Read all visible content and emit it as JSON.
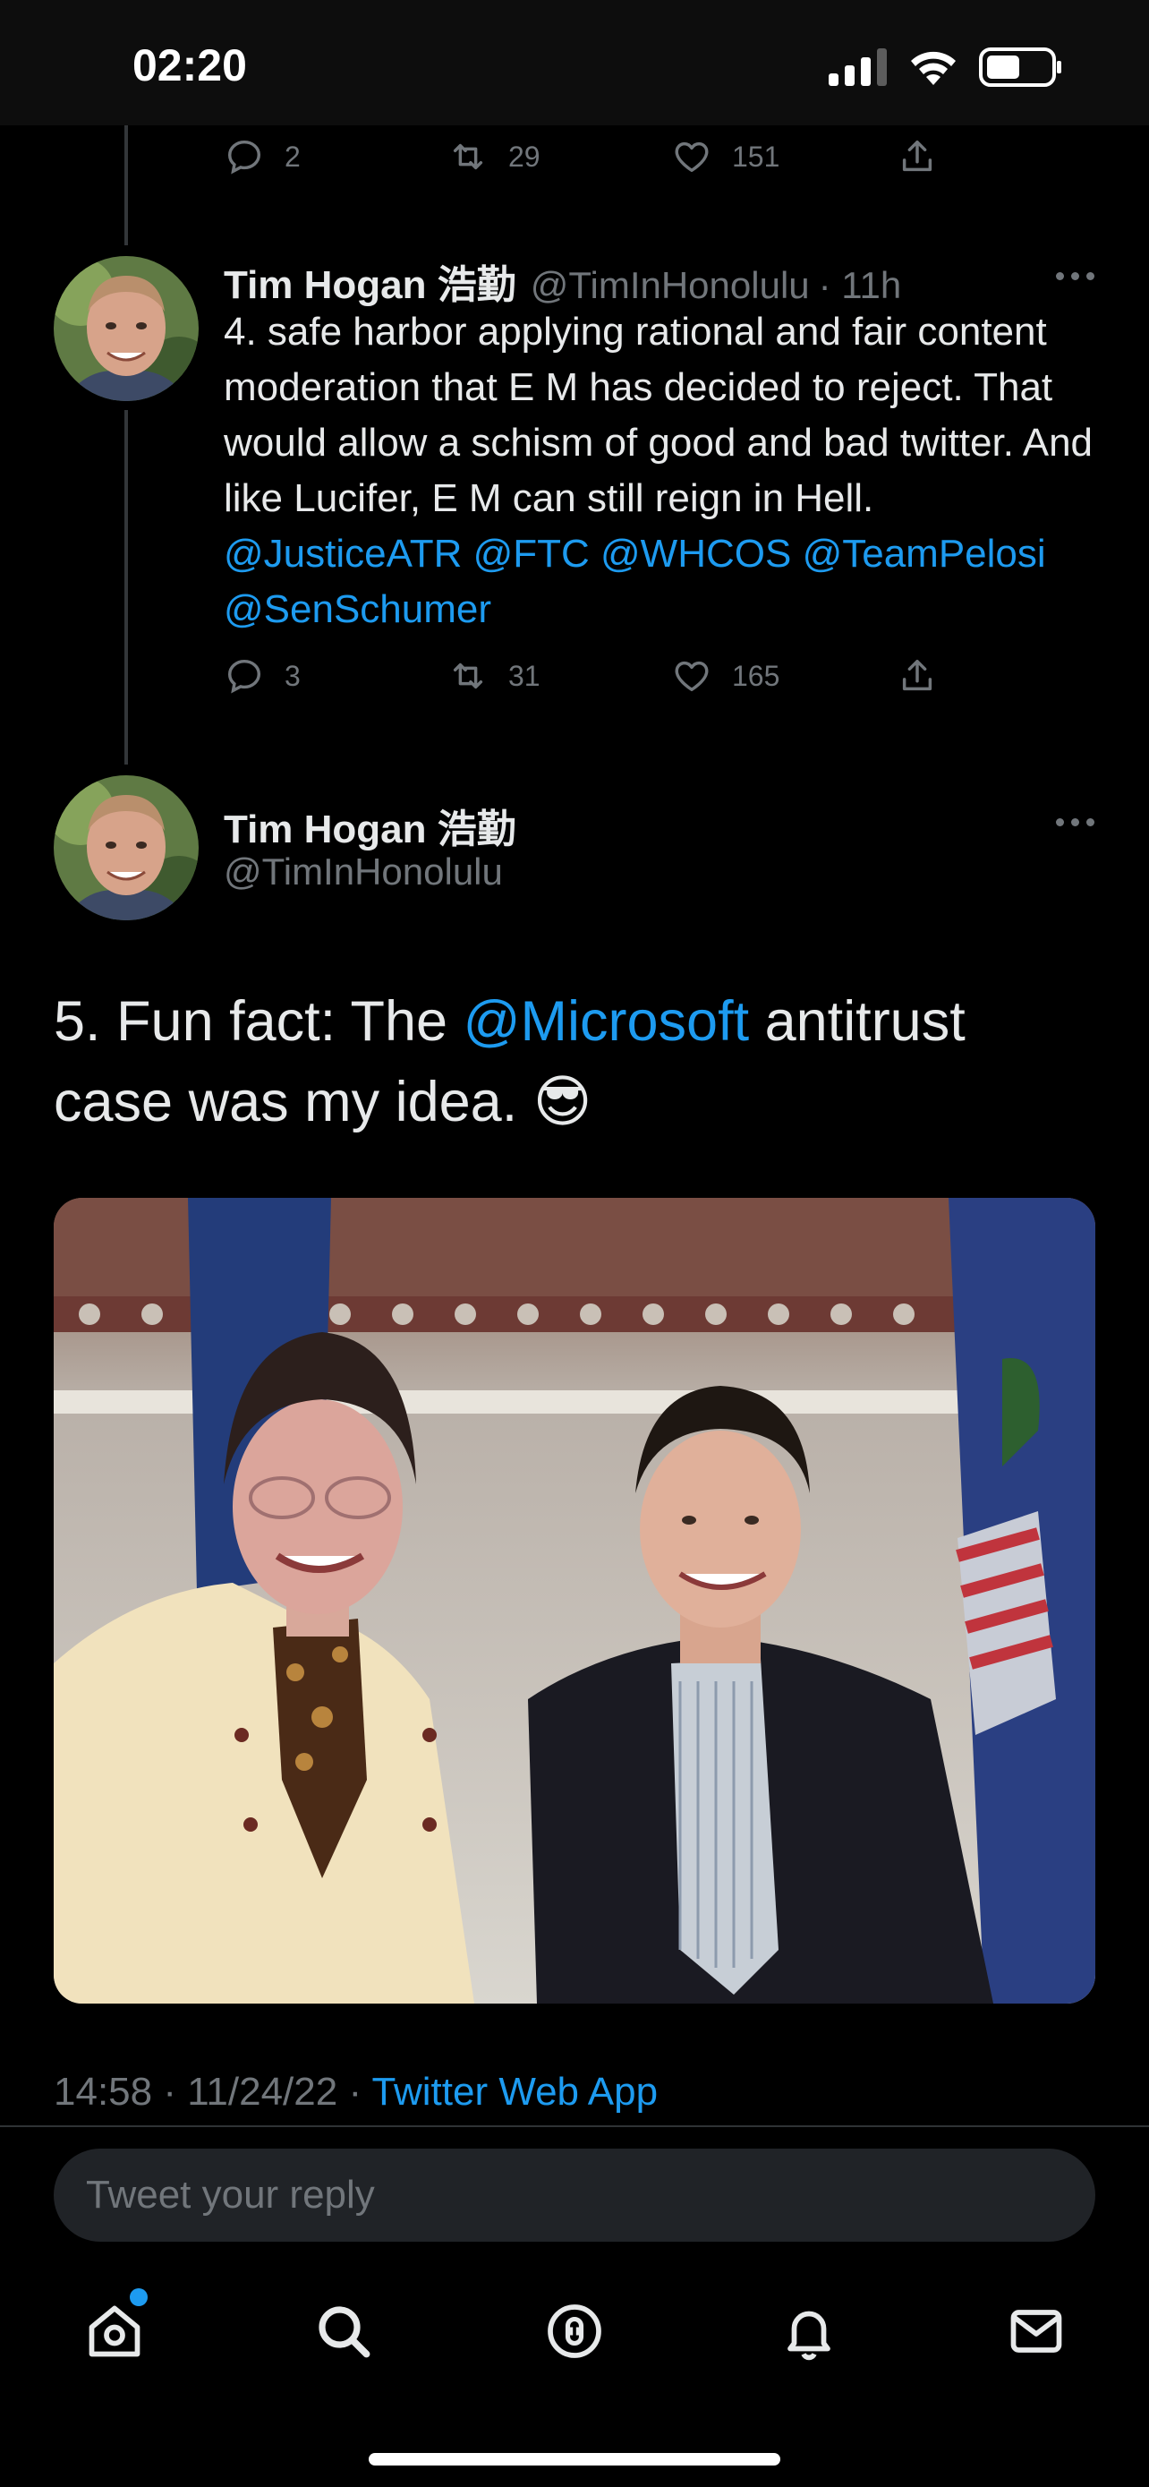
{
  "status_bar": {
    "time": "02:20"
  },
  "tweet_prev_actions": {
    "replies": "2",
    "retweets": "29",
    "likes": "151"
  },
  "tweet4": {
    "name": "Tim Hogan 浩勤",
    "handle": "@TimInHonolulu",
    "time": "· 11h",
    "text_plain": "4. safe harbor applying rational and fair content moderation that E M has decided to reject. That would allow a schism of good and bad twitter. And like Lucifer, E M can still reign in Hell.",
    "mentions": [
      "@JusticeATR",
      "@FTC",
      "@WHCOS",
      "@TeamPelosi",
      "@SenSchumer"
    ],
    "replies": "3",
    "retweets": "31",
    "likes": "165"
  },
  "main_tweet": {
    "name": "Tim Hogan 浩勤",
    "handle": "@TimInHonolulu",
    "text_before": "5. Fun fact: The",
    "mention": "@Microsoft",
    "text_after": "antitrust case was my idea.",
    "emoji": "😎",
    "timestamp": "14:58 · 11/24/22 ·",
    "client": "Twitter Web App"
  },
  "reply": {
    "placeholder": "Tweet your reply"
  },
  "tabs": [
    "home-icon",
    "search-icon",
    "spaces-icon",
    "notifications-icon",
    "messages-icon"
  ],
  "colors": {
    "accent": "#1d9bf0",
    "background": "#000000",
    "muted": "#71767b"
  }
}
